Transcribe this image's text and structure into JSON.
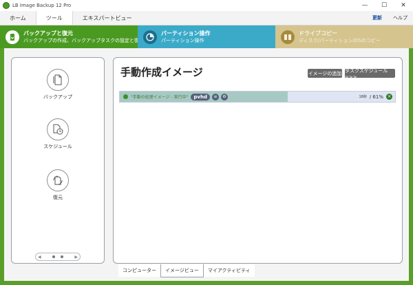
{
  "window": {
    "title": "LB Image Backup 12 Pro",
    "minimize": "—",
    "maximize": "☐",
    "close": "✕"
  },
  "menu": {
    "tabs": [
      {
        "label": "ホーム"
      },
      {
        "label": "ツール"
      },
      {
        "label": "エキスパートビュー"
      }
    ],
    "active": "ツール",
    "update": "更新",
    "help": "ヘルプ"
  },
  "bands": [
    {
      "title": "バックアップと復元",
      "subtitle": "バックアップの作成、バックアップタスクの設定と復..."
    },
    {
      "title": "パーティション操作",
      "subtitle": "パーティション操作"
    },
    {
      "title": "ドライブコピー",
      "subtitle": "ディスク/パーティション/OSのコピー"
    }
  ],
  "sidebar": {
    "items": [
      {
        "label": "バックアップ",
        "icon": "backup-icon"
      },
      {
        "label": "スケジュール",
        "icon": "schedule-icon"
      },
      {
        "label": "復元",
        "icon": "restore-icon"
      }
    ],
    "pager_prev": "◀",
    "pager_next": "▶"
  },
  "main": {
    "title": "手動作成イメージ",
    "add_image_button": "イメージの追加",
    "task_schedule_button": "タスクスケジュール >>>",
    "task": {
      "name": "\"手動の処理イメージ - 実行中\"",
      "format": "pvhd",
      "time": "18秒",
      "percent": "/ 61%",
      "progress": 0.61,
      "close": "×"
    }
  },
  "bottom_tabs": [
    {
      "label": "コンピューター"
    },
    {
      "label": "イメージビュー"
    },
    {
      "label": "マイアクティビティ"
    }
  ],
  "bottom_active": "イメージビュー",
  "colors": {
    "green": "#4a9a22",
    "blue": "#3aaac8",
    "tan": "#d5c48e",
    "progress": "#a7c9c4"
  }
}
